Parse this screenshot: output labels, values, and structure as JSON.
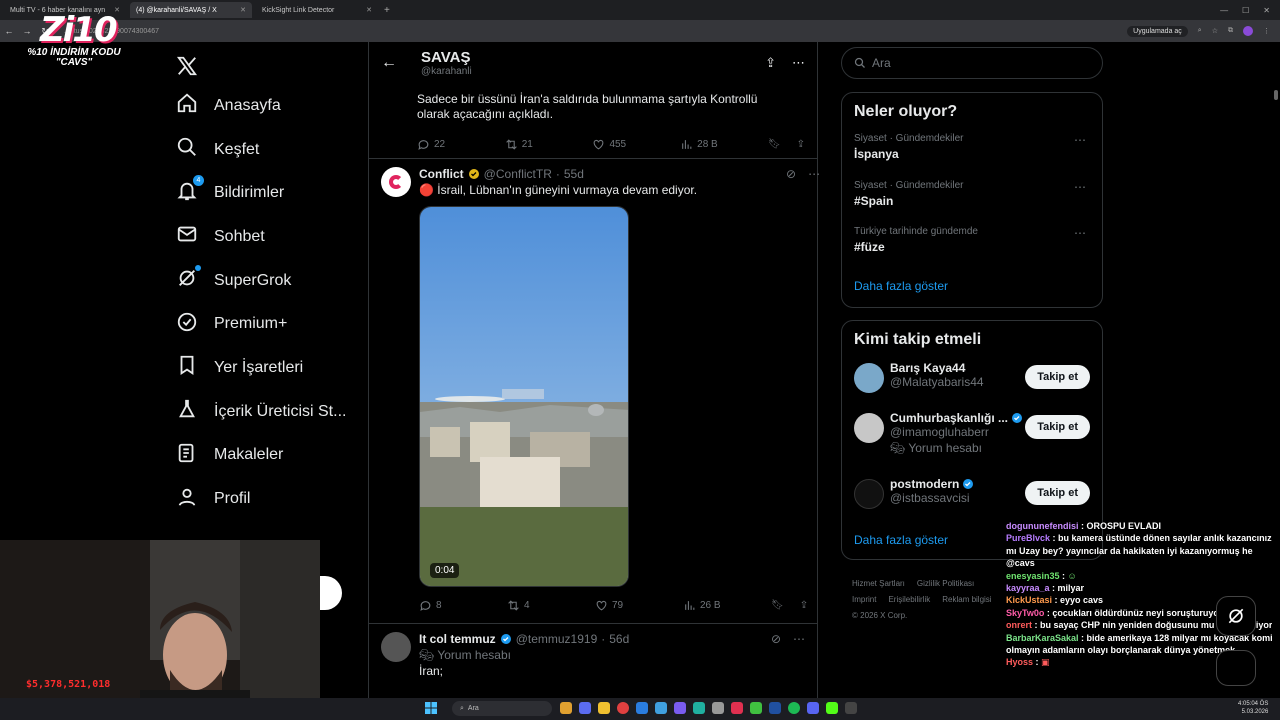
{
  "browser": {
    "tabs": [
      {
        "title": "Multi TV - 6 haber kanalını ayn",
        "active": false
      },
      {
        "title": "(4) @karahanli/SAVAŞ / X",
        "active": true
      },
      {
        "title": "KickSight Link Detector",
        "active": false
      }
    ],
    "url": "...atus/2027822690074300467",
    "open_in_app": "Uygulamada aç"
  },
  "overlay": {
    "logo": "Zi10",
    "promo_line1": "%10 İNDİRİM KODU",
    "promo_line2": "\"CAVS\"",
    "counter": "$5,378,521,018"
  },
  "nav": {
    "items": [
      {
        "label": "Anasayfa",
        "icon": "home-icon"
      },
      {
        "label": "Keşfet",
        "icon": "search-icon"
      },
      {
        "label": "Bildirimler",
        "icon": "bell-icon",
        "badge": "4"
      },
      {
        "label": "Sohbet",
        "icon": "mail-icon"
      },
      {
        "label": "SuperGrok",
        "icon": "grok-icon"
      },
      {
        "label": "Premium+",
        "icon": "verified-icon"
      },
      {
        "label": "Yer İşaretleri",
        "icon": "bookmark-icon"
      },
      {
        "label": "İçerik Üreticisi St...",
        "icon": "flask-icon"
      },
      {
        "label": "Makaleler",
        "icon": "article-icon"
      },
      {
        "label": "Profil",
        "icon": "person-icon"
      }
    ]
  },
  "header": {
    "title": "SAVAŞ",
    "handle": "@karahanli"
  },
  "tweets": [
    {
      "text": "Sadece bir üssünü İran'a saldırıda bulunmama şartıyla Kontrollü olarak açacağını açıkladı.",
      "replies": "22",
      "reposts": "21",
      "likes": "455",
      "views": "28 B"
    },
    {
      "name": "Conflict",
      "handle": "@ConflictTR",
      "time": "55d",
      "text": "🔴 İsrail, Lübnan'ın güneyini vurmaya devam ediyor.",
      "video_duration": "0:04",
      "replies": "8",
      "reposts": "4",
      "likes": "79",
      "views": "26 B"
    },
    {
      "name": "It col temmuz",
      "handle": "@temmuz1919",
      "time": "56d",
      "subtag": "Yorum hesabı",
      "text": "İran;"
    }
  ],
  "right": {
    "search_placeholder": "Ara",
    "trends_title": "Neler oluyor?",
    "trends": [
      {
        "category": "Siyaset · Gündemdekiler",
        "value": "İspanya"
      },
      {
        "category": "Siyaset · Gündemdekiler",
        "value": "#Spain"
      },
      {
        "category": "Türkiye tarihinde gündemde",
        "value": "#füze"
      }
    ],
    "show_more": "Daha fazla göster",
    "follow_title": "Kimi takip etmeli",
    "follow": [
      {
        "name": "Barış Kaya44",
        "handle": "@Malatyabaris44",
        "verified": false
      },
      {
        "name": "Cumhurbaşkanlığı ...",
        "handle": "@imamogluhaberr",
        "verified": true,
        "subtag": "Yorum hesabı"
      },
      {
        "name": "postmodern",
        "handle": "@istbassavcisi",
        "verified": true
      }
    ],
    "follow_button": "Takip et",
    "follow_show_more": "Daha fazla göster",
    "footer": {
      "links1": [
        "Hizmet Şartları",
        "Gizlilik Politikası"
      ],
      "links2": [
        "Imprint",
        "Erişilebilirlik",
        "Reklam bilgisi"
      ],
      "copyright": "© 2026 X Corp."
    }
  },
  "chat": [
    {
      "user": "dogununefendisi",
      "msg": "OROSPU EVLADI"
    },
    {
      "user": "PureBlvck",
      "msg": "bu kamera üstünde dönen sayılar anlık kazancınız mı Uzay bey? yayıncılar da hakikaten iyi kazanıyormuş he @cavs"
    },
    {
      "user": "enesyasin35",
      "msg": ""
    },
    {
      "user": "kayyraa_a",
      "msg": "milyar"
    },
    {
      "user": "KickUstasi",
      "msg": "eyyo cavs"
    },
    {
      "user": "SkyTw0o",
      "msg": "çocukları öldürdünüz neyi soruşturuyon"
    },
    {
      "user": "onrert",
      "msg": "bu sayaç CHP nin yeniden doğusunu mu temsil ediyor"
    },
    {
      "user": "BarbarKaraSakal",
      "msg": "bide amerikaya 128 milyar mı koyacak komik olmayın adamların olayı borçlanarak dünya yönetmek"
    },
    {
      "user": "Hyoss",
      "msg": ""
    }
  ],
  "taskbar": {
    "search": "Ara",
    "time": "4:05:04 ÖS",
    "date": "5.03.2026"
  }
}
